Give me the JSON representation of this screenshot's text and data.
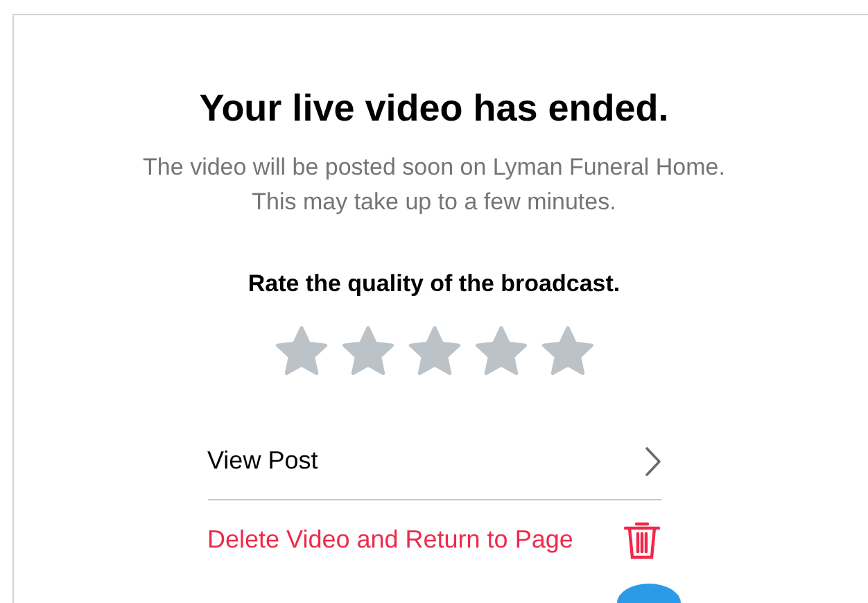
{
  "dialog": {
    "title": "Your live video has ended.",
    "message_lines": [
      "The video will be posted soon on Lyman Funeral Home.",
      "This may take up to a few minutes."
    ],
    "rating": {
      "prompt": "Rate the quality of the broadcast.",
      "stars": 0
    },
    "actions": [
      {
        "kind": "link",
        "label": "View Post"
      },
      {
        "kind": "destructive",
        "label": "Delete Video and Return to Page"
      }
    ]
  }
}
